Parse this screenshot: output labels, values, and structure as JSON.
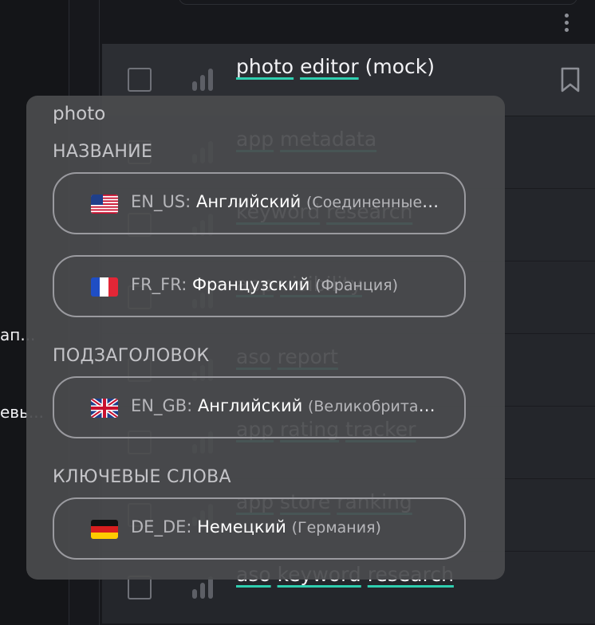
{
  "left_panel": {
    "snippet_1": "ап...",
    "snippet_2": "евь..."
  },
  "list": {
    "rows": [
      {
        "words": [
          "photo",
          "editor"
        ],
        "suffix": "(mock)"
      },
      {
        "words": [
          "app",
          "metadata"
        ],
        "suffix": ""
      },
      {
        "words": [
          "keyword",
          "research"
        ],
        "suffix": ""
      },
      {
        "words": [
          "app",
          "visibility"
        ],
        "suffix": ""
      },
      {
        "words": [
          "aso",
          "report"
        ],
        "suffix": ""
      },
      {
        "words": [
          "app",
          "rating",
          "tracker"
        ],
        "suffix": ""
      },
      {
        "words": [
          "app",
          "store",
          "ranking"
        ],
        "suffix": ""
      },
      {
        "words": [
          "aso",
          "keyword",
          "research"
        ],
        "suffix": ""
      }
    ]
  },
  "popover": {
    "query": "photo",
    "sections": [
      {
        "title": "НАЗВАНИЕ",
        "options": [
          {
            "flag": "us-flag-icon",
            "code": "EN_US:",
            "language": "Английский",
            "region": "(Соединенные Штаты)"
          },
          {
            "flag": "fr-flag-icon",
            "code": "FR_FR:",
            "language": "Французский",
            "region": "(Франция)"
          }
        ]
      },
      {
        "title": "ПОДЗАГОЛОВОК",
        "options": [
          {
            "flag": "gb-flag-icon",
            "code": "EN_GB:",
            "language": "Английский",
            "region": "(Великобритания)"
          }
        ]
      },
      {
        "title": "КЛЮЧЕВЫЕ СЛОВА",
        "options": [
          {
            "flag": "de-flag-icon",
            "code": "DE_DE:",
            "language": "Немецкий",
            "region": "(Германия)"
          }
        ]
      }
    ]
  },
  "colors": {
    "accent_underline": "#2fcfb0",
    "popover_bg": "#4a4b4e",
    "row_bg": "#24262b"
  }
}
